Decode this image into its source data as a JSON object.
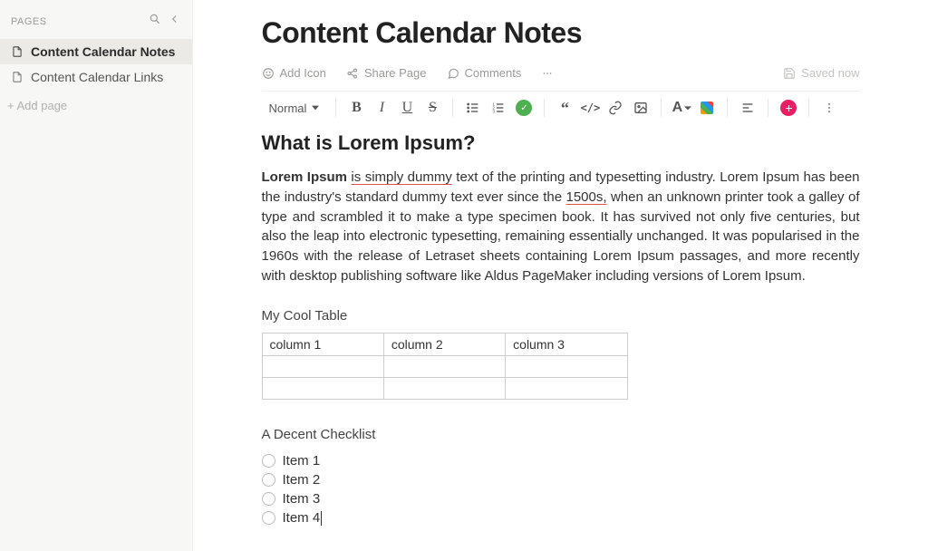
{
  "sidebar": {
    "title": "PAGES",
    "pages": [
      {
        "label": "Content Calendar Notes",
        "active": true
      },
      {
        "label": "Content Calendar Links",
        "active": false
      }
    ],
    "add_page": "+ Add page"
  },
  "doc": {
    "title": "Content Calendar Notes",
    "meta": {
      "add_icon": "Add Icon",
      "share_page": "Share Page",
      "comments": "Comments",
      "saved": "Saved now"
    },
    "toolbar": {
      "format_label": "Normal",
      "font_color_label": "A"
    },
    "heading": "What is Lorem Ipsum?",
    "para": {
      "bold": "Lorem Ipsum",
      "u1": "is simply dummy",
      "t1": " text of the printing and typesetting industry. Lorem Ipsum has been the industry's standard dummy text ever since the ",
      "u2": "1500s,",
      "t2": " when an unknown printer took a galley of type and scrambled it to make a type specimen book. It has survived not only five centuries, but also the leap into electronic typesetting, remaining essentially unchanged. It was popularised in the 1960s with the release of Letraset sheets containing Lorem Ipsum passages, and more recently with desktop publishing software like Aldus PageMaker including versions of Lorem Ipsum."
    },
    "table_caption": "My Cool Table",
    "table": {
      "cols": [
        "column 1",
        "column 2",
        "column 3"
      ]
    },
    "checklist_caption": "A Decent Checklist",
    "checklist": [
      "Item 1",
      "Item 2",
      "Item 3",
      "Item 4"
    ]
  }
}
